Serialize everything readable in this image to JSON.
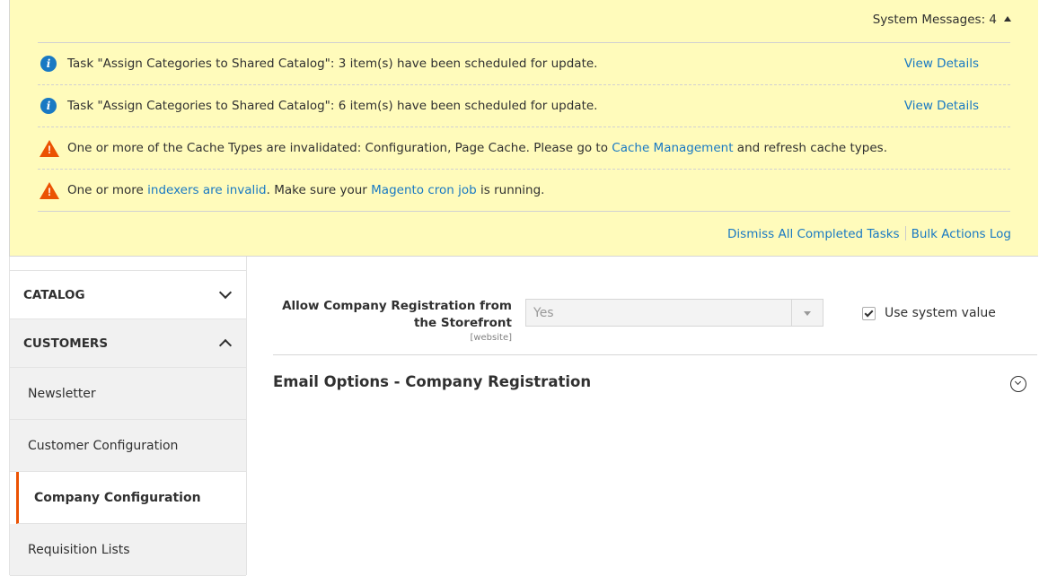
{
  "system_messages": {
    "title": "System Messages: 4",
    "messages": [
      {
        "type": "info",
        "text": "Task \"Assign Categories to Shared Catalog\": 3 item(s) have been scheduled for update.",
        "action": "View Details"
      },
      {
        "type": "info",
        "text": "Task \"Assign Categories to Shared Catalog\": 6 item(s) have been scheduled for update.",
        "action": "View Details"
      },
      {
        "type": "warning",
        "pre": "One or more of the Cache Types are invalidated: Configuration, Page Cache. Please go to ",
        "link": "Cache Management",
        "post": " and refresh cache types."
      },
      {
        "type": "warning",
        "pre": "One or more ",
        "link": "indexers are invalid",
        "mid": ". Make sure your ",
        "link2": "Magento cron job",
        "post": " is running."
      }
    ],
    "dismiss": "Dismiss All Completed Tasks",
    "bulk_log": "Bulk Actions Log"
  },
  "sidebar": {
    "sections": [
      {
        "label": "CATALOG"
      },
      {
        "label": "CUSTOMERS"
      }
    ],
    "items": [
      {
        "label": "Newsletter"
      },
      {
        "label": "Customer Configuration"
      },
      {
        "label": "Company Configuration"
      },
      {
        "label": "Requisition Lists"
      }
    ]
  },
  "main": {
    "field": {
      "label": "Allow Company Registration from the Storefront",
      "scope": "[website]",
      "value": "Yes",
      "use_system": "Use system value"
    },
    "section_title": "Email Options - Company Registration"
  },
  "colors": {
    "accent": "#eb5202",
    "link": "#1979c3",
    "message_bg": "#fffbbb"
  }
}
